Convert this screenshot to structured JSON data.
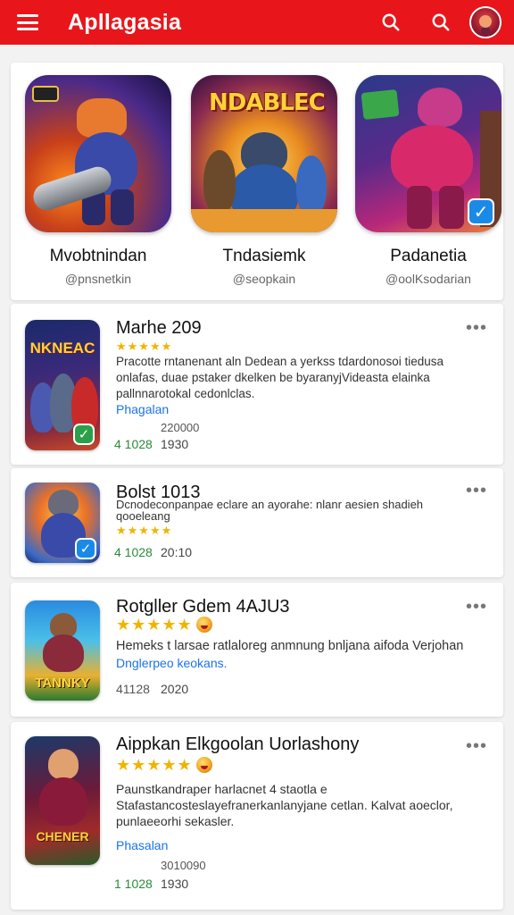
{
  "app": {
    "title": "Apllagasia",
    "icons": [
      "menu-icon",
      "search-icon",
      "search-icon",
      "avatar"
    ],
    "colors": {
      "appbar": "#e8161b",
      "link": "#1a73e8",
      "stars": "#f0b400",
      "downloads": "#2a8a3a"
    }
  },
  "featured": [
    {
      "name": "Mvobtnindan",
      "handle": "@pnsnetkin",
      "art_title": ""
    },
    {
      "name": "Tndasiemk",
      "handle": "@seopkain",
      "art_title": "NDABLEC"
    },
    {
      "name": "Padanetia",
      "handle": "@oolKsodarian",
      "art_title": ""
    }
  ],
  "cards": [
    {
      "title": "Marhe 209",
      "stars": "★★★★★",
      "description": "Pracotte rntanenant aln Dedean a yerkss tdardonosoi tiedusa onlafas, duae pstaker dkelken be byaranyjVideasta elainka pallnnarotokal cedonlclas.",
      "link": "Phagalan",
      "number": "220000",
      "downloads": "4 1028",
      "count": "1930",
      "thumb_title": "NKNEAC",
      "more_icon": "more-icon"
    },
    {
      "title": "Bolst 1013",
      "stars": "★★★★★",
      "description": "Dcnodeconpanpae eclare an ayorahe: nlanr aesien shadieh qooeleang",
      "downloads": "4 1028",
      "count": "20:10",
      "more_icon": "more-icon"
    },
    {
      "title": "Rotgller Gdem 4AJU3",
      "stars": "★★★★★",
      "description": "Hemeks t larsae ratlaloreg anmnung bnljana aifoda Verjohan",
      "link": "Dnglerpeo keokans.",
      "downloads": "41128",
      "count": "2020",
      "thumb_title": "TANNKY",
      "more_icon": "more-icon"
    },
    {
      "title": "Aippkan Elkgoolan Uorlashony",
      "stars": "★★★★★",
      "description": "Paunstkandraper harlacnet 4 staotla e Stafastancosteslayefranerkanlanyjane cetlan. Kalvat aoeclor, punlaeeorhi sekasler.",
      "link": "Phasalan",
      "number": "3010090",
      "downloads": "1 1028",
      "count": "1930",
      "thumb_title": "CHENER",
      "more_icon": "more-icon"
    }
  ]
}
